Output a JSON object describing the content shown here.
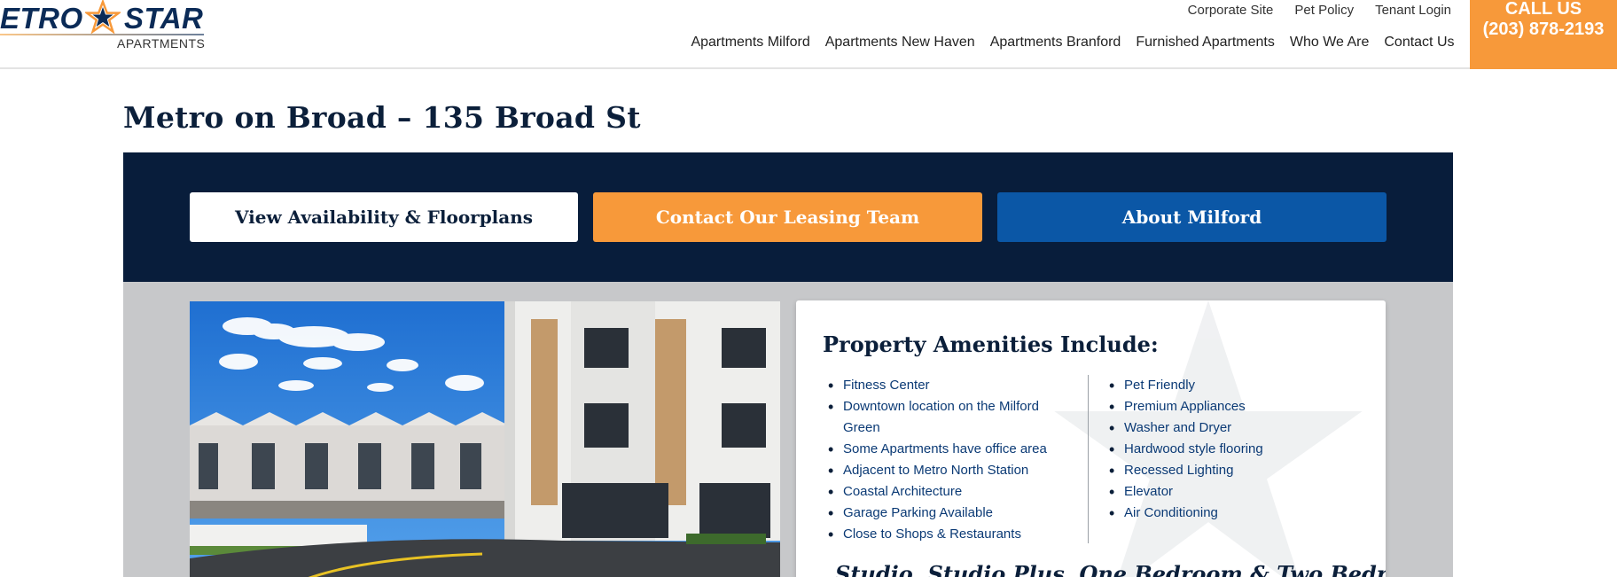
{
  "brand": {
    "logo_left": "ETRO",
    "logo_right": "STAR",
    "logo_sub": "APARTMENTS"
  },
  "top_links": [
    "Corporate Site",
    "Pet Policy",
    "Tenant Login"
  ],
  "main_nav": [
    "Apartments Milford",
    "Apartments New Haven",
    "Apartments Branford",
    "Furnished Apartments",
    "Who We Are",
    "Contact Us"
  ],
  "call": {
    "title": "CALL US",
    "number": "(203) 878-2193"
  },
  "page": {
    "title": "Metro on Broad – 135 Broad St"
  },
  "cta": {
    "availability": "View Availability & Floorplans",
    "leasing": "Contact Our Leasing Team",
    "about": "About Milford"
  },
  "amenities": {
    "title": "Property Amenities Include:",
    "left": [
      "Fitness Center",
      "Downtown location on the Milford Green",
      "Some Apartments have office area",
      "Adjacent to Metro North Station",
      "Coastal Architecture",
      "Garage Parking Available",
      "Close to Shops & Restaurants"
    ],
    "right": [
      "Pet Friendly",
      "Premium Appliances",
      "Washer and Dryer",
      "Hardwood style flooring",
      "Recessed Lighting",
      "Elevator",
      "Air Conditioning"
    ],
    "subtitle": "Studio, Studio Plus, One Bedroom & Two Bedroom"
  },
  "colors": {
    "navy": "#081d3b",
    "orange": "#f7993a",
    "blue": "#0b57a6"
  }
}
